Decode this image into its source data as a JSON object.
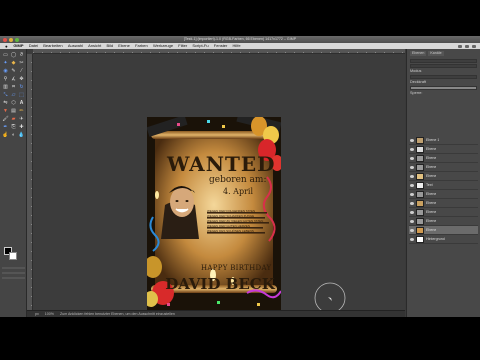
{
  "window": {
    "title": "[Testi-1] (importiert)-1.0 (RGB-Farben, 66 Ebenen) 1417x1772 – GIMP"
  },
  "menubar": {
    "app": "GIMP",
    "items": [
      "Datei",
      "Bearbeiten",
      "Auswahl",
      "Ansicht",
      "Bild",
      "Ebene",
      "Farben",
      "Werkzeuge",
      "Filter",
      "Script-Fu",
      "Fenster",
      "Hilfe"
    ]
  },
  "poster": {
    "headline": "WANTED",
    "born_label": "geboren am:",
    "born_date": "4. April",
    "lines": [
      "WEGEN DER FOLGENDEN TATEN",
      "WEGEN DER SCHARFEN ZUNGE",
      "WEGEN DER ZU VIELEN GUTEN TATEN",
      "WEGEN DER GUTEN HERZEN",
      "WEGEN DES SCHÖNEN LEBENS"
    ],
    "greeting": "HAPPY BIRTHDAY",
    "name": "DAVID BECK"
  },
  "statusbar": {
    "unit": "px",
    "zoom": "100%",
    "message": "Zum Anklicken fehlen benutzter Ebenen, um den Ausschnitt einzustellen"
  },
  "dock": {
    "tab1": "Ebenen",
    "tab2": "Kanäle",
    "mode_label": "Modus",
    "opacity_label": "Deckkraft",
    "lock_label": "Sperre:",
    "layers": [
      "Ebene 1",
      "Ebene",
      "Ebene",
      "Ebene",
      "Ebene",
      "Text",
      "Ebene",
      "Ebene",
      "Ebene",
      "Ebene",
      "Ebene",
      "Hintergrund"
    ]
  },
  "colors": {
    "accent": "#d8a24a",
    "ink": "#2a1b0a",
    "paper": "#c8954a"
  }
}
